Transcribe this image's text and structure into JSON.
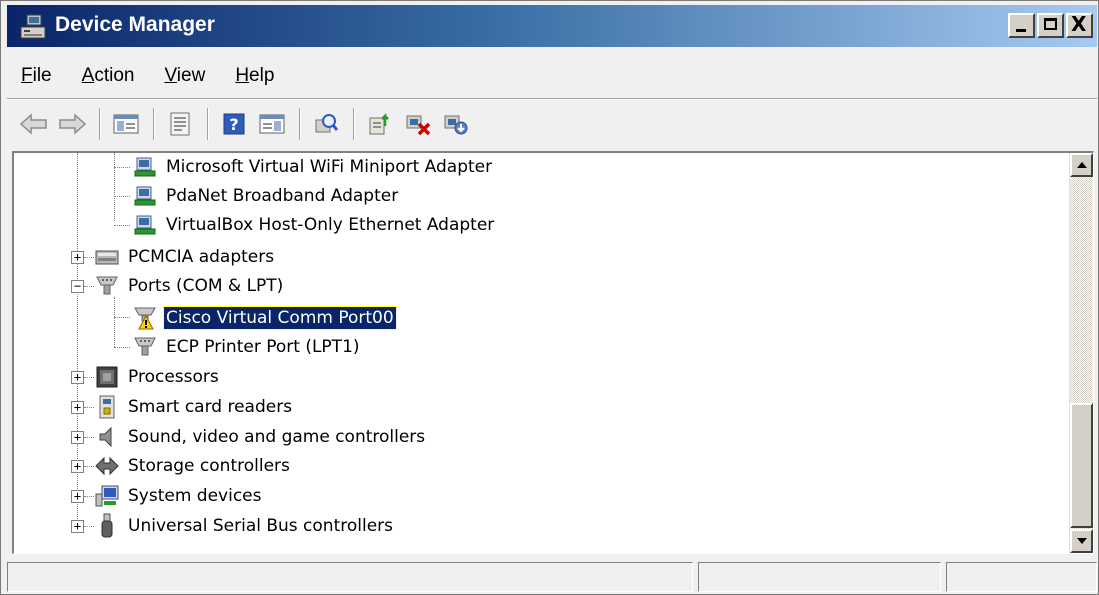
{
  "window": {
    "title": "Device Manager",
    "controls": {
      "minimize": "_",
      "maximize": "□",
      "close": "X"
    }
  },
  "menu": [
    {
      "accel": "F",
      "rest": "ile"
    },
    {
      "accel": "A",
      "rest": "ction"
    },
    {
      "accel": "V",
      "rest": "iew"
    },
    {
      "accel": "H",
      "rest": "elp"
    }
  ],
  "toolbar": {
    "icons": [
      "back-arrow-icon",
      "forward-arrow-icon",
      "show-hide-console-tree-icon",
      "properties-icon",
      "help-icon",
      "action-pane-icon",
      "scan-hardware-icon",
      "update-driver-icon",
      "uninstall-device-icon",
      "disable-device-icon"
    ]
  },
  "tree": {
    "items": [
      {
        "label": "Microsoft Virtual WiFi Miniport Adapter",
        "icon": "network-adapter-icon",
        "level": 2
      },
      {
        "label": "PdaNet Broadband Adapter",
        "icon": "network-adapter-icon",
        "level": 2
      },
      {
        "label": "VirtualBox Host-Only Ethernet Adapter",
        "icon": "network-adapter-icon",
        "level": 2
      },
      {
        "label": "PCMCIA adapters",
        "icon": "pcmcia-icon",
        "level": 1,
        "expander": "+"
      },
      {
        "label": "Ports (COM & LPT)",
        "icon": "port-icon",
        "level": 1,
        "expander": "−"
      },
      {
        "label": "Cisco Virtual Comm Port00",
        "icon": "port-warning-icon",
        "level": 2,
        "selected": true
      },
      {
        "label": "ECP Printer Port (LPT1)",
        "icon": "port-icon",
        "level": 2
      },
      {
        "label": "Processors",
        "icon": "processor-icon",
        "level": 1,
        "expander": "+"
      },
      {
        "label": "Smart card readers",
        "icon": "smart-card-icon",
        "level": 1,
        "expander": "+"
      },
      {
        "label": "Sound, video and game controllers",
        "icon": "speaker-icon",
        "level": 1,
        "expander": "+"
      },
      {
        "label": "Storage controllers",
        "icon": "storage-icon",
        "level": 1,
        "expander": "+"
      },
      {
        "label": "System devices",
        "icon": "system-icon",
        "level": 1,
        "expander": "+"
      },
      {
        "label": "Universal Serial Bus controllers",
        "icon": "usb-icon",
        "level": 1,
        "expander": "+"
      }
    ]
  },
  "colors": {
    "selection": "#0a246a",
    "title_start": "#0a246a",
    "title_end": "#a6caf0"
  }
}
